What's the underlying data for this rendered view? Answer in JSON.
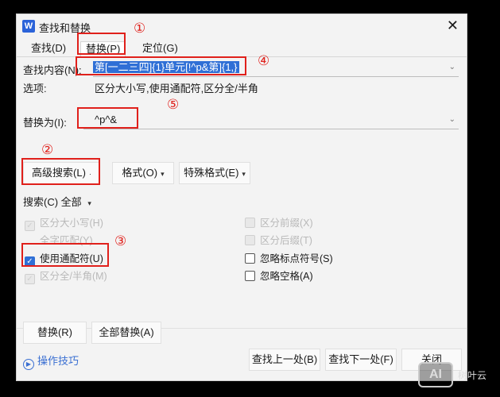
{
  "window": {
    "title": "查找和替换",
    "app_icon": "W"
  },
  "tabs": [
    "查找(D)",
    "替换(P)",
    "定位(G)"
  ],
  "find": {
    "label": "查找内容(N):",
    "value": "第[一二三四]{1}单元[!^p&第]{1,}"
  },
  "options_line": {
    "label": "选项:",
    "text": "区分大小写,使用通配符,区分全/半角"
  },
  "replace": {
    "label": "替换为(I):",
    "value": "^p^&"
  },
  "buttons": {
    "advanced": "高级搜索(L)",
    "format": "格式(O)",
    "special": "特殊格式(E)",
    "replace": "替换(R)",
    "replace_all": "全部替换(A)",
    "find_prev": "查找上一处(B)",
    "find_next": "查找下一处(F)",
    "close": "关闭"
  },
  "search": {
    "label": "搜索(C)",
    "value": "全部"
  },
  "checkboxes": {
    "match_case": "区分大小写(H)",
    "whole_word": "全字匹配(Y)",
    "use_wildcards": "使用通配符(U)",
    "full_half": "区分全/半角(M)",
    "prefix": "区分前缀(X)",
    "suffix": "区分后缀(T)",
    "ignore_punct": "忽略标点符号(S)",
    "ignore_space": "忽略空格(A)"
  },
  "tips": "操作技巧",
  "annotations": [
    "①",
    "②",
    "③",
    "④",
    "⑤"
  ],
  "watermark": {
    "logo": "AI",
    "text": "树叶云"
  },
  "colors": {
    "annotation_red": "#e0201b",
    "selection_blue": "#2f6fd6"
  }
}
